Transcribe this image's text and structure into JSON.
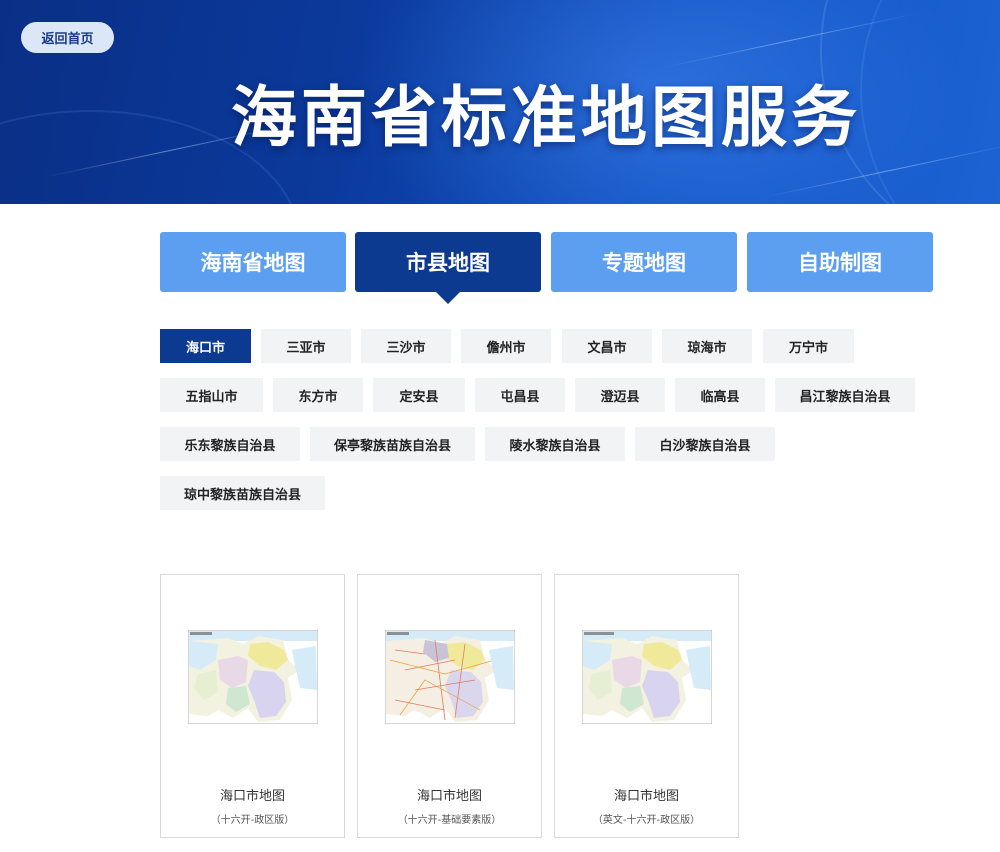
{
  "header": {
    "back_label": "返回首页",
    "title": "海南省标准地图服务"
  },
  "tabs": [
    {
      "label": "海南省地图",
      "active": false
    },
    {
      "label": "市县地图",
      "active": true
    },
    {
      "label": "专题地图",
      "active": false
    },
    {
      "label": "自助制图",
      "active": false
    }
  ],
  "regions": [
    {
      "label": "海口市",
      "active": true
    },
    {
      "label": "三亚市",
      "active": false
    },
    {
      "label": "三沙市",
      "active": false
    },
    {
      "label": "儋州市",
      "active": false
    },
    {
      "label": "文昌市",
      "active": false
    },
    {
      "label": "琼海市",
      "active": false
    },
    {
      "label": "万宁市",
      "active": false
    },
    {
      "label": "五指山市",
      "active": false
    },
    {
      "label": "东方市",
      "active": false
    },
    {
      "label": "定安县",
      "active": false
    },
    {
      "label": "屯昌县",
      "active": false
    },
    {
      "label": "澄迈县",
      "active": false
    },
    {
      "label": "临高县",
      "active": false
    },
    {
      "label": "昌江黎族自治县",
      "active": false
    },
    {
      "label": "乐东黎族自治县",
      "active": false
    },
    {
      "label": "保亭黎族苗族自治县",
      "active": false
    },
    {
      "label": "陵水黎族自治县",
      "active": false
    },
    {
      "label": "白沙黎族自治县",
      "active": false
    },
    {
      "label": "琼中黎族苗族自治县",
      "active": false
    }
  ],
  "maps": [
    {
      "name": "海口市地图",
      "edition": "（十六开-政区版）"
    },
    {
      "name": "海口市地图",
      "edition": "（十六开-基础要素版）"
    },
    {
      "name": "海口市地图",
      "edition": "（英文-十六开-政区版）"
    }
  ],
  "colors": {
    "tab_active": "#0d3a91",
    "tab_inactive": "#5c9ff0",
    "chip_bg": "#f2f3f5"
  }
}
